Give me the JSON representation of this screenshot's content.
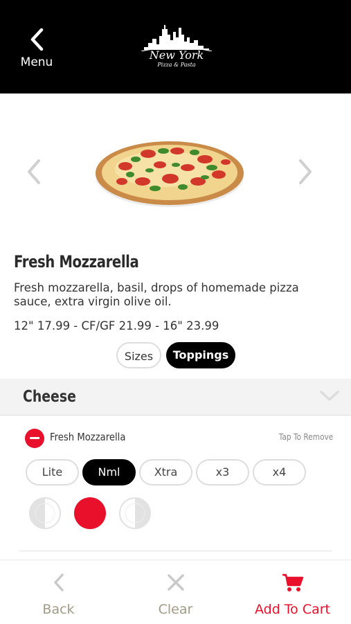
{
  "header": {
    "back_label": "Menu",
    "logo_title": "New York",
    "logo_subtitle": "Pizza & Pasta"
  },
  "item": {
    "name": "Fresh Mozzarella",
    "description": "Fresh mozzarella, basil, drops of homemade pizza sauce, extra virgin olive oil.",
    "price": "12\" 17.99 - CF/GF 21.99 - 16\" 23.99"
  },
  "tabs": {
    "sizes": "Sizes",
    "toppings": "Toppings"
  },
  "section": {
    "title": "Cheese"
  },
  "topping": {
    "name": "Fresh Mozzarella",
    "hint": "Tap To Remove",
    "amounts": [
      "Lite",
      "Nml",
      "Xtra",
      "x3",
      "x4"
    ],
    "selected_amount": "Nml"
  },
  "footer": {
    "back": "Back",
    "clear": "Clear",
    "add_to_cart": "Add To Cart"
  },
  "colors": {
    "accent": "#e8102a",
    "header_bg": "#000000",
    "footer_label": "#a09a86"
  }
}
